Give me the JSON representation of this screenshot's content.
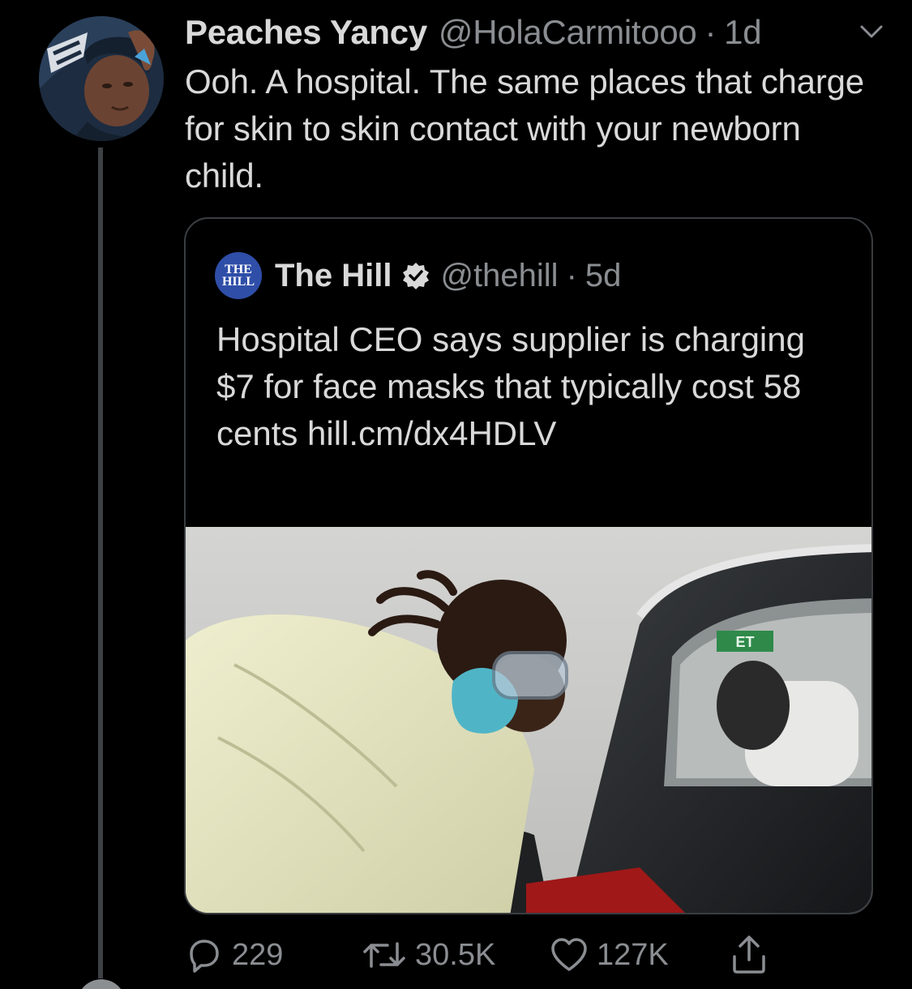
{
  "tweet": {
    "display_name": "Peaches Yancy",
    "handle": "@HolaCarmitooo",
    "separator": "·",
    "time": "1d",
    "text": "Ooh. A hospital. The same places that charge for skin to skin contact with your newborn child."
  },
  "quoted_tweet": {
    "logo_text_top": "THE",
    "logo_text_bottom": "HILL",
    "display_name": "The Hill",
    "verified": true,
    "handle": "@thehill",
    "separator": "·",
    "time": "5d",
    "text": "Hospital CEO says supplier is charging $7 for face masks that typically cost 58 cents  hill.cm/dx4HDLV",
    "image_badge_text": "ET"
  },
  "actions": {
    "reply_count": "229",
    "retweet_count": "30.5K",
    "like_count": "127K"
  },
  "icons": [
    "chevron-down-icon",
    "verified-badge-icon",
    "reply-icon",
    "retweet-icon",
    "like-icon",
    "share-icon"
  ],
  "colors": {
    "background": "#000000",
    "text_primary": "#d9d9d9",
    "text_secondary": "#8a8d91",
    "border": "#3a3d40",
    "thread_line": "#3d4144",
    "hill_logo": "#2f4ea8"
  }
}
